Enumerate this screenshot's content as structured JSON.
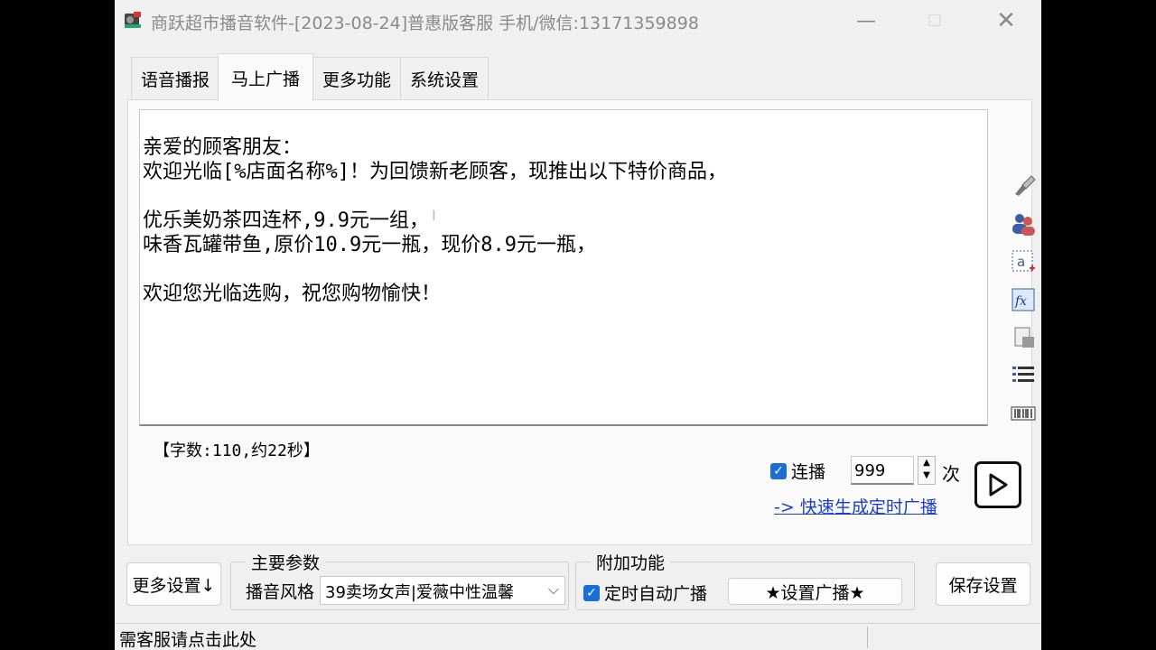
{
  "window": {
    "title": "商跃超市播音软件-[2023-08-24]普惠版客服 手机/微信:13171359898",
    "min_glyph": "—",
    "max_glyph": "☐",
    "close_glyph": "✕"
  },
  "tabs": [
    {
      "label": "语音播报",
      "active": false
    },
    {
      "label": "马上广播",
      "active": true
    },
    {
      "label": "更多功能",
      "active": false
    },
    {
      "label": "系统设置",
      "active": false
    }
  ],
  "editor": {
    "content": "亲爱的顾客朋友：\n欢迎光临[%店面名称%]！为回馈新老顾客，现推出以下特价商品，\n\n优乐美奶茶四连杯,9.9元一组，\n味香瓦罐带鱼,原价10.9元一瓶，现价8.9元一瓶，\n\n欢迎您光临选购，祝您购物愉快！",
    "cursor_glyph": "I"
  },
  "toolbar": [
    {
      "icon": "brush-icon"
    },
    {
      "icon": "users-icon"
    },
    {
      "icon": "insert-text-icon"
    },
    {
      "icon": "function-icon"
    },
    {
      "icon": "scroll-icon"
    },
    {
      "icon": "list-icon"
    },
    {
      "icon": "barcode-icon"
    }
  ],
  "char_count": "【字数:110,约22秒】",
  "loop": {
    "checked_glyph": "✓",
    "label": "连播",
    "value": "999",
    "unit": "次",
    "spin_up": "▲",
    "spin_down": "▼"
  },
  "quick_link": "-> 快速生成定时广播",
  "bottom": {
    "more_settings": "更多设置↓",
    "save_settings": "保存设置",
    "main_params": {
      "title": "主要参数",
      "style_label": "播音风格",
      "style_value": "39卖场女声|爱薇中性温馨",
      "arrow": "⌵"
    },
    "extra": {
      "title": "附加功能",
      "auto_label": "定时自动广播",
      "set_button": "★设置广播★"
    }
  },
  "status": "需客服请点击此处",
  "colors": {
    "accent": "#1a6fd6",
    "link": "#1a3fcc"
  }
}
